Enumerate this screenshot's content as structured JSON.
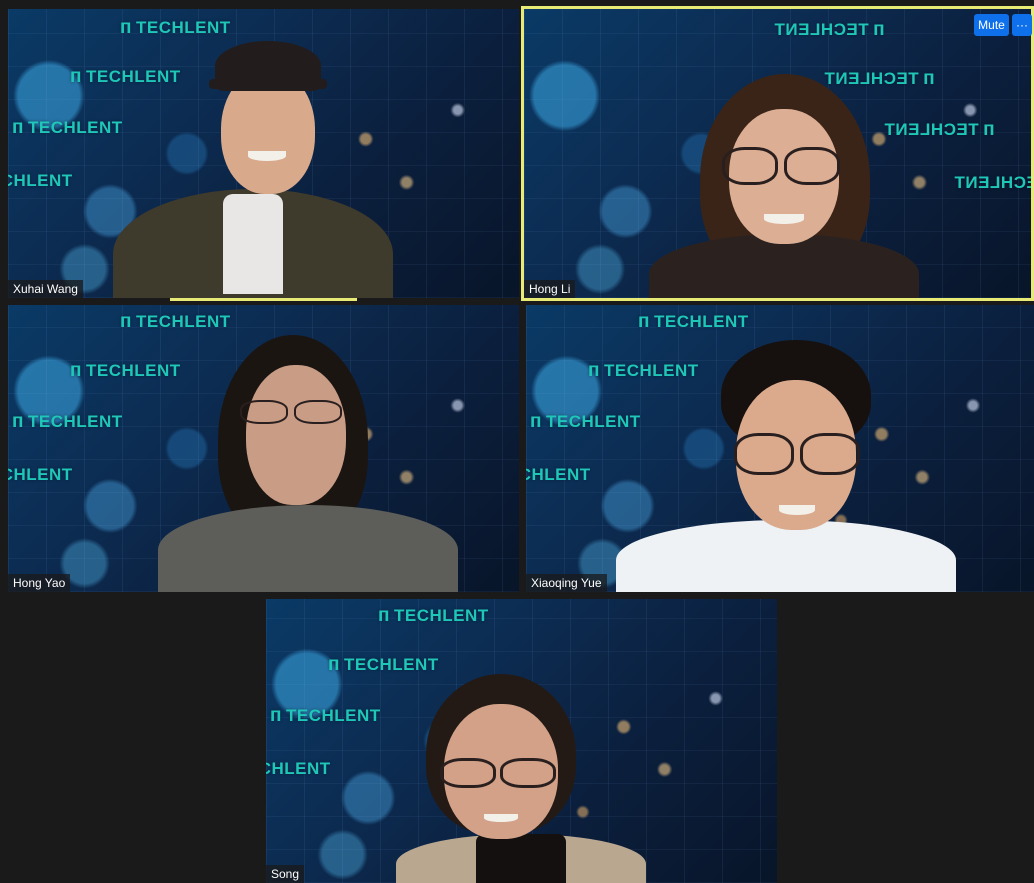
{
  "brand_text": "TECHLENT",
  "brand_logo": "ᴨ",
  "controls": {
    "mute_label": "Mute",
    "more_label": "···"
  },
  "participants": [
    {
      "name": "Xuhai Wang"
    },
    {
      "name": "Hong Li"
    },
    {
      "name": "Hong Yao"
    },
    {
      "name": "Xiaoqing Yue"
    },
    {
      "name": "Song"
    }
  ],
  "colors": {
    "active_speaker": "#e8ea76",
    "brand": "#1fc7b8",
    "button": "#0e71eb"
  }
}
